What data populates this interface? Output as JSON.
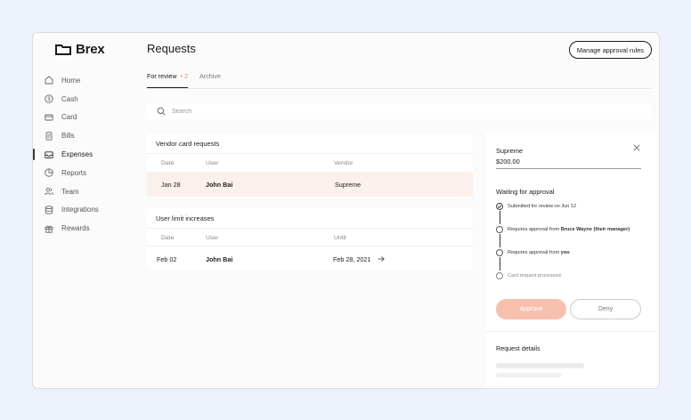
{
  "brand": {
    "name": "Brex"
  },
  "nav": [
    {
      "label": "Home",
      "icon": "home-icon"
    },
    {
      "label": "Cash",
      "icon": "dollar-icon"
    },
    {
      "label": "Card",
      "icon": "card-icon"
    },
    {
      "label": "Bills",
      "icon": "bills-icon"
    },
    {
      "label": "Expenses",
      "icon": "inbox-icon",
      "active": true
    },
    {
      "label": "Reports",
      "icon": "pie-chart-icon"
    },
    {
      "label": "Team",
      "icon": "team-icon"
    },
    {
      "label": "Integrations",
      "icon": "database-icon"
    },
    {
      "label": "Rewards",
      "icon": "gift-icon"
    }
  ],
  "header": {
    "title": "Requests",
    "manage_button": "Manage approval rules"
  },
  "tabs": [
    {
      "label": "For review",
      "count": "2",
      "active": true
    },
    {
      "label": "Archive"
    }
  ],
  "search": {
    "placeholder": "Search"
  },
  "vendor_card": {
    "title": "Vendor card requests",
    "columns": [
      "Date",
      "User",
      "Vendor"
    ],
    "rows": [
      {
        "date": "Jan 28",
        "user": "John Bai",
        "vendor": "Supreme",
        "selected": true
      }
    ]
  },
  "limit_card": {
    "title": "User limit increases",
    "columns": [
      "Date",
      "User",
      "Until"
    ],
    "rows": [
      {
        "date": "Feb 02",
        "user": "John Bai",
        "until": "Feb 28, 2021"
      }
    ]
  },
  "details": {
    "vendor": "Supreme",
    "amount": "$200.00",
    "waiting_title": "Waiting for approval",
    "steps": [
      {
        "pre": "Submitted for review on Jun 12",
        "bold": "",
        "post": "",
        "state": "done"
      },
      {
        "pre": "Requires approval from ",
        "bold": "Bruce Wayne (their manager)",
        "post": "",
        "state": "current"
      },
      {
        "pre": "Requires approval from ",
        "bold": "you",
        "post": "",
        "state": "current"
      },
      {
        "pre": "Card request processed",
        "bold": "",
        "post": "",
        "state": "pending"
      }
    ],
    "approve_label": "Approve",
    "deny_label": "Deny",
    "request_details_title": "Request details"
  },
  "colors": {
    "accent": "#f7c0ad",
    "selected_row": "#faf0ec",
    "background": "#eef2fd"
  }
}
